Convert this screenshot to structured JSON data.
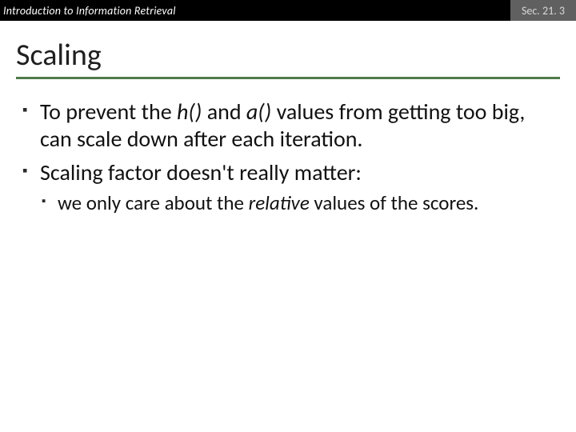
{
  "header": {
    "left": "Introduction to Information Retrieval",
    "right": "Sec. 21. 3"
  },
  "title": "Scaling",
  "bullets": {
    "b1a": "To prevent the ",
    "b1b": "h()",
    "b1c": " and ",
    "b1d": "a()",
    "b1e": " values from getting too big, can scale down after each iteration.",
    "b2": "Scaling factor doesn't really matter:",
    "b2s1a": "we only care about the ",
    "b2s1b": "relative",
    "b2s1c": " values of the scores."
  }
}
